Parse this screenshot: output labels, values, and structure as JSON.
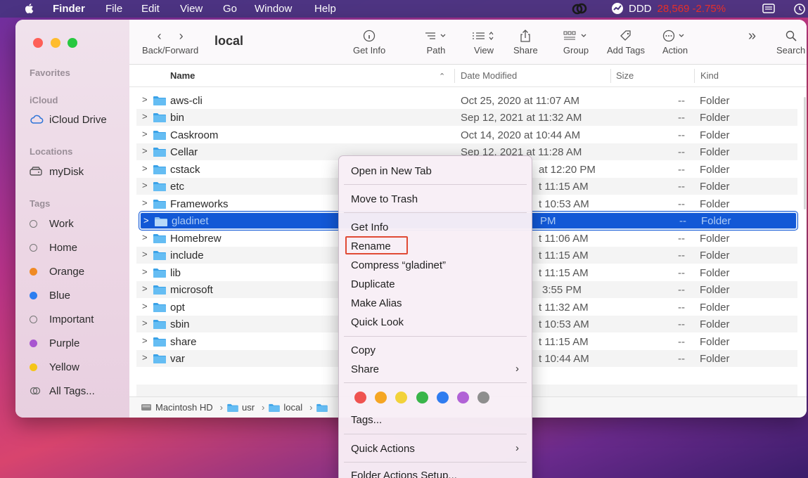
{
  "menubar": {
    "app_name": "Finder",
    "items": [
      "File",
      "Edit",
      "View",
      "Go",
      "Window",
      "Help"
    ],
    "status_name": "DDD",
    "status_value": "28,569 -2.75%"
  },
  "window": {
    "title": "local",
    "toolbar": {
      "back_forward": "Back/Forward",
      "get_info": "Get Info",
      "path": "Path",
      "view": "View",
      "share": "Share",
      "group": "Group",
      "add_tags": "Add Tags",
      "action": "Action",
      "search": "Search"
    },
    "sidebar": {
      "favorites": "Favorites",
      "icloud": "iCloud",
      "icloud_drive": "iCloud Drive",
      "locations": "Locations",
      "mydisk": "myDisk",
      "tags_header": "Tags",
      "tags": [
        {
          "label": "Work",
          "color": "none"
        },
        {
          "label": "Home",
          "color": "none"
        },
        {
          "label": "Orange",
          "color": "#f08a24"
        },
        {
          "label": "Blue",
          "color": "#2c7ef0"
        },
        {
          "label": "Important",
          "color": "none"
        },
        {
          "label": "Purple",
          "color": "#a855d0"
        },
        {
          "label": "Yellow",
          "color": "#f5c518"
        }
      ],
      "all_tags": "All Tags..."
    },
    "columns": {
      "name": "Name",
      "date": "Date Modified",
      "size": "Size",
      "kind": "Kind"
    },
    "rows": [
      {
        "name": "aws-cli",
        "date": "Oct 25, 2020 at 11:07 AM",
        "size": "--",
        "kind": "Folder"
      },
      {
        "name": "bin",
        "date": "Sep 12, 2021 at 11:32 AM",
        "size": "--",
        "kind": "Folder"
      },
      {
        "name": "Caskroom",
        "date": "Oct 14, 2020 at 10:44 AM",
        "size": "--",
        "kind": "Folder"
      },
      {
        "name": "Cellar",
        "date": "Sep 12, 2021 at 11:28 AM",
        "size": "--",
        "kind": "Folder"
      },
      {
        "name": "cstack",
        "date": "at 12:20 PM",
        "size": "--",
        "kind": "Folder"
      },
      {
        "name": "etc",
        "date": "t 11:15 AM",
        "size": "--",
        "kind": "Folder"
      },
      {
        "name": "Frameworks",
        "date": "t 10:53 AM",
        "size": "--",
        "kind": "Folder"
      },
      {
        "name": "gladinet",
        "date": "PM",
        "size": "--",
        "kind": "Folder"
      },
      {
        "name": "Homebrew",
        "date": "t 11:06 AM",
        "size": "--",
        "kind": "Folder"
      },
      {
        "name": "include",
        "date": "t 11:15 AM",
        "size": "--",
        "kind": "Folder"
      },
      {
        "name": "lib",
        "date": "t 11:15 AM",
        "size": "--",
        "kind": "Folder"
      },
      {
        "name": "microsoft",
        "date": "3:55 PM",
        "size": "--",
        "kind": "Folder"
      },
      {
        "name": "opt",
        "date": "t 11:32 AM",
        "size": "--",
        "kind": "Folder"
      },
      {
        "name": "sbin",
        "date": "t 10:53 AM",
        "size": "--",
        "kind": "Folder"
      },
      {
        "name": "share",
        "date": "t 11:15 AM",
        "size": "--",
        "kind": "Folder"
      },
      {
        "name": "var",
        "date": "t 10:44 AM",
        "size": "--",
        "kind": "Folder"
      }
    ],
    "pathbar": [
      "Macintosh HD",
      "usr",
      "local"
    ]
  },
  "context_menu": {
    "open_new_tab": "Open in New Tab",
    "move_to_trash": "Move to Trash",
    "get_info": "Get Info",
    "rename": "Rename",
    "compress": "Compress “gladinet”",
    "duplicate": "Duplicate",
    "make_alias": "Make Alias",
    "quick_look": "Quick Look",
    "copy": "Copy",
    "share": "Share",
    "tag_colors": [
      "#ef5350",
      "#f5a623",
      "#f2d23a",
      "#39b54a",
      "#2f7cf0",
      "#b162d6",
      "#8e8e8e"
    ],
    "tags": "Tags...",
    "quick_actions": "Quick Actions",
    "folder_actions": "Folder Actions Setup..."
  },
  "colors": {
    "selection": "#1258d6",
    "rename_highlight": "#e04a35"
  }
}
